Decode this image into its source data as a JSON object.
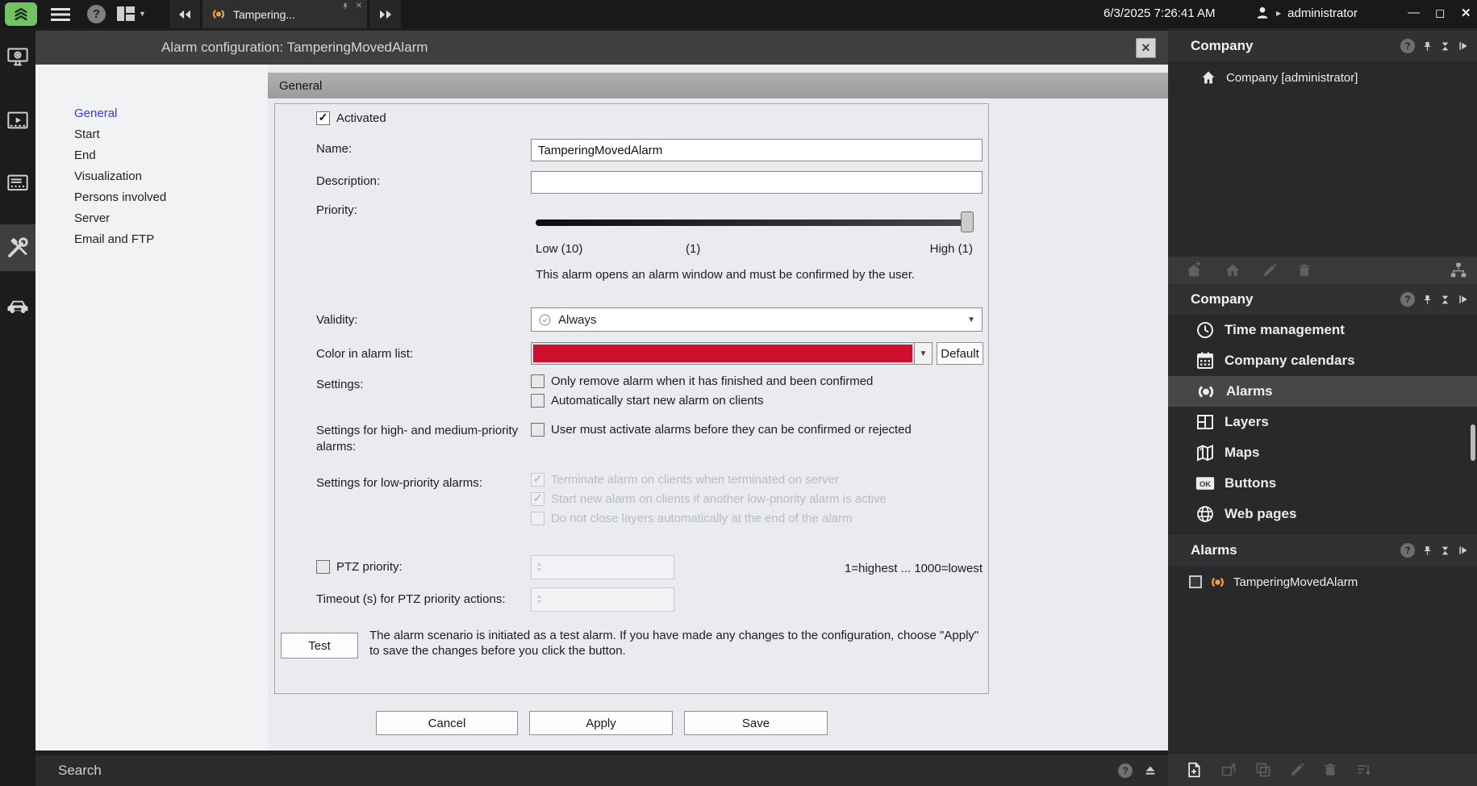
{
  "top_bar": {
    "datetime": "6/3/2025 7:26:41 AM",
    "user": "administrator",
    "tab": {
      "label": "Tampering..."
    },
    "help_glyph": "?"
  },
  "dialog": {
    "title": "Alarm configuration: TamperingMovedAlarm",
    "section_title": "General",
    "nav": [
      {
        "label": "General",
        "selected": true
      },
      {
        "label": "Start"
      },
      {
        "label": "End"
      },
      {
        "label": "Visualization"
      },
      {
        "label": "Persons involved"
      },
      {
        "label": "Server"
      },
      {
        "label": "Email and FTP"
      }
    ],
    "form": {
      "activated": {
        "label": "Activated",
        "checked": true
      },
      "name": {
        "label": "Name:",
        "value": "TamperingMovedAlarm"
      },
      "description": {
        "label": "Description:",
        "value": ""
      },
      "priority": {
        "label": "Priority:",
        "scale_low": "Low (10)",
        "scale_mid": "(1)",
        "scale_high": "High (1)",
        "note": "This alarm opens an alarm window and must be confirmed by the user."
      },
      "validity": {
        "label": "Validity:",
        "value": "Always"
      },
      "color": {
        "label": "Color in alarm list:",
        "value_hex": "#ce0e2d",
        "default_button": "Default"
      },
      "settings": {
        "label": "Settings:",
        "options": [
          {
            "label": "Only remove alarm when it has finished and been confirmed",
            "checked": false
          },
          {
            "label": "Automatically start new alarm on clients",
            "checked": false
          }
        ]
      },
      "high_priority": {
        "label": "Settings for high- and medium-priority alarms:",
        "options": [
          {
            "label": "User must activate alarms before they can be confirmed or rejected",
            "checked": false
          }
        ]
      },
      "low_priority": {
        "label": "Settings for low-priority alarms:",
        "options": [
          {
            "label": "Terminate alarm on clients when terminated on server",
            "checked": true,
            "disabled": true
          },
          {
            "label": "Start new alarm on clients if another low-priority alarm is active",
            "checked": true,
            "disabled": true
          },
          {
            "label": "Do not close layers automatically at the end of the alarm",
            "checked": false,
            "disabled": true
          }
        ]
      },
      "ptz": {
        "label": "PTZ priority:",
        "checked": false,
        "value": "",
        "hint": "1=highest ... 1000=lowest"
      },
      "timeout": {
        "label": "Timeout (s) for PTZ priority actions:",
        "value": ""
      },
      "test": {
        "button": "Test",
        "note": "The alarm scenario is initiated as a test alarm. If you have made any changes to the configuration, choose \"Apply\" to save the changes before you click the button."
      }
    },
    "buttons": {
      "cancel": "Cancel",
      "apply": "Apply",
      "save": "Save"
    }
  },
  "right_panel": {
    "explorer": {
      "title": "Company",
      "root_item": "Company [administrator]"
    },
    "company_section": {
      "title": "Company",
      "items": [
        {
          "label": "Time management",
          "icon": "clock-icon"
        },
        {
          "label": "Company calendars",
          "icon": "calendar-icon"
        },
        {
          "label": "Alarms",
          "icon": "alarm-icon",
          "selected": true
        },
        {
          "label": "Layers",
          "icon": "layers-icon"
        },
        {
          "label": "Maps",
          "icon": "map-icon"
        },
        {
          "label": "Buttons",
          "icon": "ok-button-icon"
        },
        {
          "label": "Web pages",
          "icon": "globe-icon"
        }
      ]
    },
    "alarms_section": {
      "title": "Alarms",
      "items": [
        {
          "label": "TamperingMovedAlarm"
        }
      ]
    }
  },
  "search": {
    "label": "Search"
  },
  "colors": {
    "alarm_red": "#ce0e2d",
    "tab_alarm_orange": "#f2a33c",
    "logo_green": "#74c163",
    "nav_selected_blue": "#3a3ad1"
  }
}
